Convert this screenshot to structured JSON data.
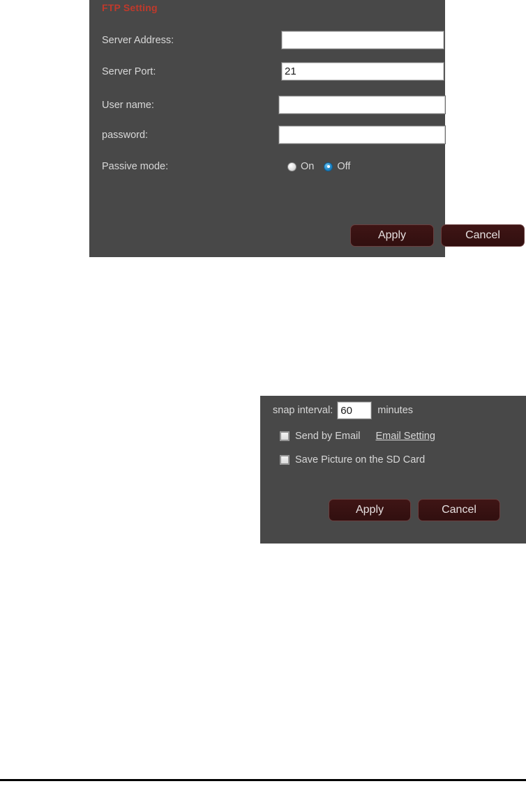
{
  "ftp_panel": {
    "title": "FTP Setting",
    "fields": [
      {
        "label": "Server Address:",
        "value": "",
        "placeholder": ""
      },
      {
        "label": "Server Port:",
        "value": "21",
        "placeholder": ""
      },
      {
        "label": "User name:",
        "value": "",
        "placeholder": ""
      },
      {
        "label": "password:",
        "value": "",
        "placeholder": ""
      }
    ],
    "passive_mode": {
      "label": "Passive mode:",
      "options": [
        {
          "label": "On",
          "selected": false
        },
        {
          "label": "Off",
          "selected": true
        }
      ]
    },
    "buttons": {
      "apply": "Apply",
      "cancel": "Cancel"
    }
  },
  "snap_panel": {
    "interval": {
      "label": "snap interval:",
      "value": "60",
      "unit": "minutes"
    },
    "checkboxes": [
      {
        "label": "Send by Email",
        "checked": false
      },
      {
        "label": "Save Picture on the SD Card",
        "checked": false
      }
    ],
    "email_setting_link": "Email Setting",
    "buttons": {
      "apply": "Apply",
      "cancel": "Cancel"
    }
  },
  "colors": {
    "panel_background": "#484848",
    "title_red": "#c0392b",
    "button_maroon": "#3a1212",
    "radio_selected_blue": "#1f86c8",
    "text_light": "#d8d8d8"
  }
}
